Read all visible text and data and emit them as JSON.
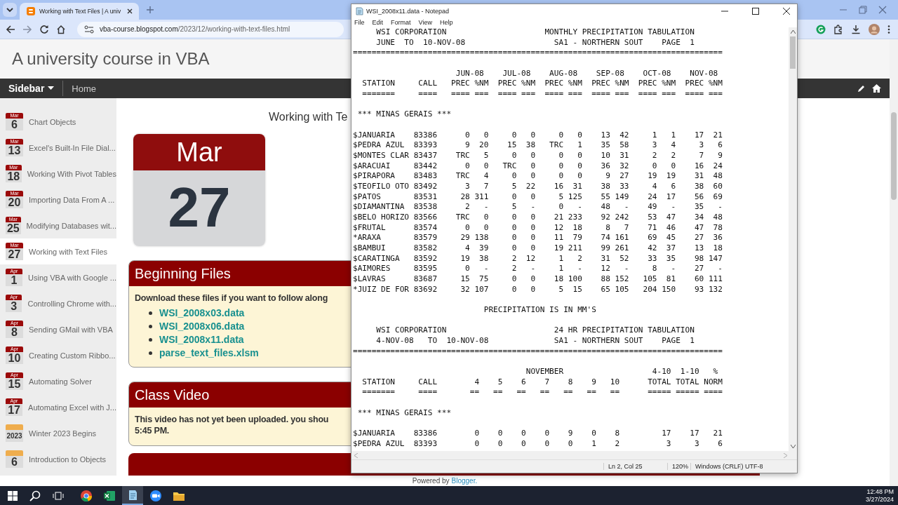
{
  "browser": {
    "tab": {
      "title": "Working with Text Files | A univ"
    },
    "address": {
      "host": "vba-course.blogspot.com",
      "path": "/2023/12/working-with-text-files.html"
    }
  },
  "blog": {
    "title": "A university course in VBA",
    "nav": [
      {
        "label": "Sidebar",
        "kind": "dropdown"
      },
      {
        "label": "Home",
        "kind": "link"
      }
    ],
    "sidebar": [
      {
        "month": "Mar",
        "day": "6",
        "title": "Chart Objects",
        "selected": false,
        "color": "#9b0a0a"
      },
      {
        "month": "Mar",
        "day": "13",
        "title": "Excel's Built-In File Dial...",
        "selected": false,
        "color": "#9b0a0a"
      },
      {
        "month": "Mar",
        "day": "18",
        "title": "Working With Pivot Tables",
        "selected": false,
        "color": "#9b0a0a"
      },
      {
        "month": "Mar",
        "day": "20",
        "title": "Importing Data From A ...",
        "selected": false,
        "color": "#9b0a0a"
      },
      {
        "month": "Mar",
        "day": "25",
        "title": "Modifying Databases wit...",
        "selected": false,
        "color": "#9b0a0a"
      },
      {
        "month": "Mar",
        "day": "27",
        "title": "Working with Text Files",
        "selected": true,
        "color": "#9b0a0a"
      },
      {
        "month": "Apr",
        "day": "1",
        "title": "Using VBA with Google ...",
        "selected": false,
        "color": "#9b0a0a"
      },
      {
        "month": "Apr",
        "day": "3",
        "title": "Controlling Chrome with...",
        "selected": false,
        "color": "#9b0a0a"
      },
      {
        "month": "Apr",
        "day": "8",
        "title": "Sending GMail with VBA",
        "selected": false,
        "color": "#9b0a0a"
      },
      {
        "month": "Apr",
        "day": "10",
        "title": "Creating Custom Ribbo...",
        "selected": false,
        "color": "#9b0a0a"
      },
      {
        "month": "Apr",
        "day": "15",
        "title": "Automating Solver",
        "selected": false,
        "color": "#9b0a0a"
      },
      {
        "month": "Apr",
        "day": "17",
        "title": "Automating Excel with J...",
        "selected": false,
        "color": "#9b0a0a"
      },
      {
        "day": "2023",
        "title": "Winter 2023 Begins",
        "selected": false,
        "color": "#efad4d"
      },
      {
        "day": "6",
        "title": "Introduction to Objects",
        "selected": false,
        "color": "#efad4d"
      }
    ],
    "post": {
      "title": "Working with Te",
      "date_month": "Mar",
      "date_day": "27",
      "sections": [
        {
          "heading": "Beginning Files",
          "intro": "Download these files if you want to follow along",
          "links": [
            "WSI_2008x03.data",
            "WSI_2008x06.data",
            "WSI_2008x11.data",
            "parse_text_files.xlsm"
          ]
        },
        {
          "heading": "Class Video",
          "lines": [
            "This video has not yet been uploaded. you shou",
            "5:45 PM."
          ]
        }
      ]
    },
    "footer": {
      "text": "Powered by",
      "link": "Blogger."
    }
  },
  "notepad": {
    "title": "WSI_2008x11.data - Notepad",
    "menu": [
      "File",
      "Edit",
      "Format",
      "View",
      "Help"
    ],
    "blocks": [
      {
        "kind": "text",
        "lines": [
          "     WSI CORPORATION                     MONTHLY PRECIPITATION TABULATION",
          "     JUNE  TO  10-NOV-08                   SA1 - NORTHERN SOUT    PAGE  1",
          "==============================================================================="
        ]
      },
      {
        "kind": "text",
        "lines": [
          "                      JUN-08    JUL-08    AUG-08    SEP-08    OCT-08    NOV-08",
          "  STATION     CALL   PREC %NM  PREC %NM  PREC %NM  PREC %NM  PREC %NM  PREC %NM",
          "  =======     ====   ==== ===  ==== ===  ==== ===  ==== ===  ==== ===  ==== ==="
        ]
      },
      {
        "kind": "text",
        "lines": [
          " *** MINAS GERAIS ***"
        ]
      },
      {
        "kind": "monthly",
        "rows": [
          {
            "station": "$JANUARIA",
            "call": "83386",
            "values": [
              "0",
              "0",
              "0",
              "0",
              "0",
              "0",
              "13",
              "42",
              "1",
              "1",
              "17",
              "21"
            ]
          },
          {
            "station": "$PEDRA AZUL",
            "call": "83393",
            "values": [
              "9",
              "20",
              "15",
              "38",
              "TRC",
              "1",
              "35",
              "58",
              "3",
              "4",
              "3",
              "6"
            ]
          },
          {
            "station": "$MONTES CLAR",
            "call": "83437",
            "values": [
              "TRC",
              "5",
              "0",
              "0",
              "0",
              "0",
              "10",
              "31",
              "2",
              "2",
              "7",
              "9"
            ]
          },
          {
            "station": "$ARACUAI",
            "call": "83442",
            "values": [
              "0",
              "0",
              "TRC",
              "0",
              "0",
              "0",
              "36",
              "32",
              "0",
              "0",
              "16",
              "24"
            ]
          },
          {
            "station": "$PIRAPORA",
            "call": "83483",
            "values": [
              "TRC",
              "4",
              "0",
              "0",
              "0",
              "0",
              "9",
              "27",
              "19",
              "19",
              "31",
              "48"
            ]
          },
          {
            "station": "$TEOFILO OTO",
            "call": "83492",
            "values": [
              "3",
              "7",
              "5",
              "22",
              "16",
              "31",
              "38",
              "33",
              "4",
              "6",
              "38",
              "60"
            ]
          },
          {
            "station": "$PATOS",
            "call": "83531",
            "values": [
              "28",
              "311",
              "0",
              "0",
              "5",
              "125",
              "55",
              "149",
              "24",
              "17",
              "56",
              "69"
            ]
          },
          {
            "station": "$DIAMANTINA",
            "call": "83538",
            "values": [
              "2",
              "-",
              "5",
              "-",
              "0",
              "-",
              "48",
              "-",
              "49",
              "-",
              "35",
              "-"
            ]
          },
          {
            "station": "$BELO HORIZO",
            "call": "83566",
            "values": [
              "TRC",
              "0",
              "0",
              "0",
              "21",
              "233",
              "92",
              "242",
              "53",
              "47",
              "34",
              "48"
            ]
          },
          {
            "station": "$FRUTAL",
            "call": "83574",
            "values": [
              "0",
              "0",
              "0",
              "0",
              "12",
              "18",
              "8",
              "7",
              "71",
              "46",
              "47",
              "78"
            ]
          },
          {
            "station": "*ARAXA",
            "call": "83579",
            "values": [
              "29",
              "138",
              "0",
              "0",
              "11",
              "79",
              "74",
              "161",
              "69",
              "45",
              "27",
              "36"
            ]
          },
          {
            "station": "$BAMBUI",
            "call": "83582",
            "values": [
              "4",
              "39",
              "0",
              "0",
              "19",
              "211",
              "99",
              "261",
              "42",
              "37",
              "13",
              "18"
            ]
          },
          {
            "station": "$CARATINGA",
            "call": "83592",
            "values": [
              "19",
              "38",
              "2",
              "12",
              "1",
              "2",
              "31",
              "52",
              "33",
              "35",
              "98",
              "147"
            ]
          },
          {
            "station": "$AIMORES",
            "call": "83595",
            "values": [
              "0",
              "-",
              "2",
              "-",
              "1",
              "-",
              "12",
              "-",
              "8",
              "-",
              "27",
              "-"
            ]
          },
          {
            "station": "$LAVRAS",
            "call": "83687",
            "values": [
              "15",
              "75",
              "0",
              "0",
              "18",
              "100",
              "88",
              "152",
              "105",
              "81",
              "60",
              "111"
            ]
          },
          {
            "station": "*JUIZ DE FOR",
            "call": "83692",
            "values": [
              "32",
              "107",
              "0",
              "0",
              "5",
              "15",
              "65",
              "105",
              "204",
              "150",
              "93",
              "132"
            ]
          }
        ]
      },
      {
        "kind": "text",
        "lines": [
          "                            PRECIPITATION IS IN MM'S"
        ]
      },
      {
        "kind": "text",
        "lines": [
          "     WSI CORPORATION                       24 HR PRECIPITATION TABULATION",
          "     4-NOV-08   TO  10-NOV-08              SA1 - NORTHERN SOUT    PAGE  1",
          "==============================================================================="
        ]
      },
      {
        "kind": "text",
        "lines": [
          "                                     NOVEMBER                   4-10  1-10   %",
          "  STATION     CALL        4    5    6    7    8    9   10      TOTAL TOTAL NORM",
          "  =======     ====       ==   ==   ==   ==   ==   ==   ==      ===== ===== ===="
        ]
      },
      {
        "kind": "text",
        "lines": [
          " *** MINAS GERAIS ***"
        ]
      },
      {
        "kind": "daily",
        "rows": [
          {
            "station": "$JANUARIA",
            "call": "83386",
            "values": [
              "0",
              "0",
              "0",
              "0",
              "9",
              "0",
              "8",
              "17",
              "17",
              "21"
            ]
          },
          {
            "station": "$PEDRA AZUL",
            "call": "83393",
            "values": [
              "0",
              "0",
              "0",
              "0",
              "0",
              "1",
              "2",
              "3",
              "3",
              "6"
            ]
          }
        ]
      }
    ],
    "status": {
      "position": "Ln 2, Col 25",
      "zoom": "120%",
      "line_ending": "Windows (CRLF)",
      "encoding": "UTF-8"
    }
  },
  "taskbar": {
    "apps": [
      {
        "kind": "chrome",
        "active": false
      },
      {
        "kind": "excel",
        "active": false
      },
      {
        "kind": "notepad",
        "active": true
      },
      {
        "kind": "zoom",
        "active": false
      },
      {
        "kind": "explorer",
        "active": false
      }
    ],
    "time": "12:48 PM",
    "date": "3/27/2024"
  }
}
